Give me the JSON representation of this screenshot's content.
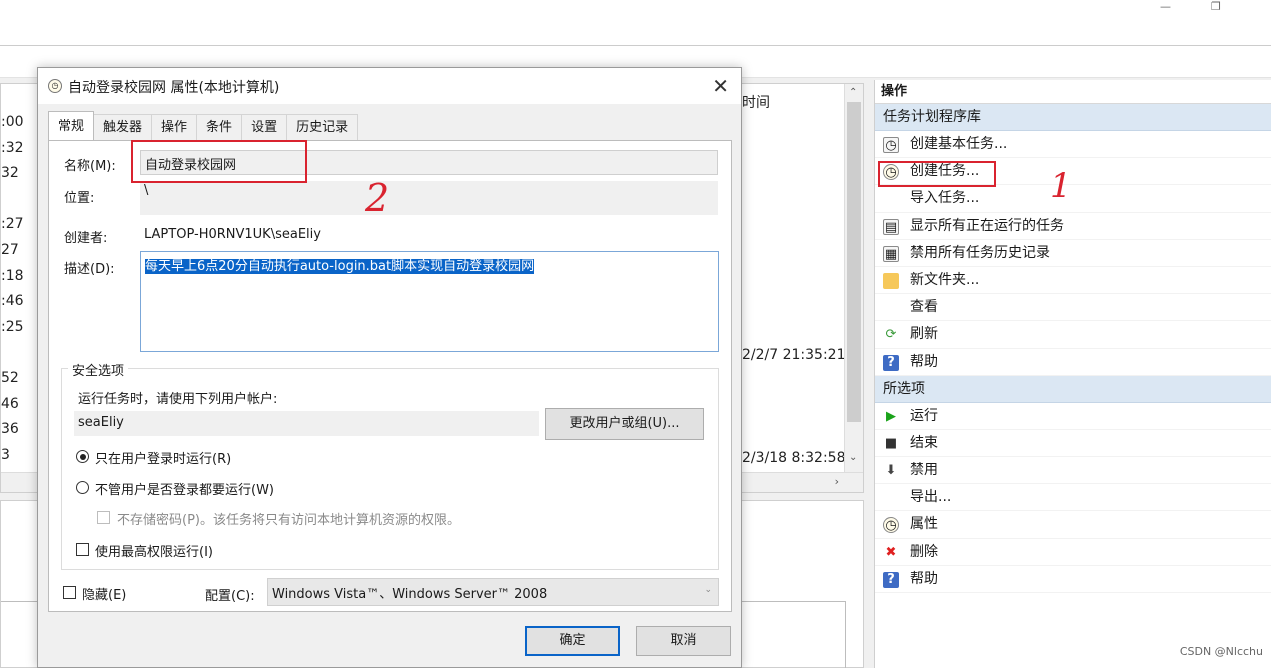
{
  "background": {
    "left_times": [
      ":00",
      ":32",
      "32",
      "",
      ":27",
      "27",
      ":18",
      ":46",
      ":25",
      "",
      "52",
      "46",
      "36",
      "3"
    ],
    "column_header": "时间",
    "dates": [
      "2/2/7 21:35:21",
      "2/3/18 8:32:58"
    ]
  },
  "actions": {
    "header": "操作",
    "section_library": "任务计划程序库",
    "library_items": [
      {
        "label": "创建基本任务...",
        "icon": "create-basic-task-icon"
      },
      {
        "label": "创建任务...",
        "icon": "create-task-icon"
      },
      {
        "label": "导入任务...",
        "icon": ""
      },
      {
        "label": "显示所有正在运行的任务",
        "icon": "running-tasks-icon"
      },
      {
        "label": "禁用所有任务历史记录",
        "icon": "history-icon"
      },
      {
        "label": "新文件夹...",
        "icon": "folder-icon"
      },
      {
        "label": "查看",
        "icon": ""
      },
      {
        "label": "刷新",
        "icon": "refresh-icon"
      },
      {
        "label": "帮助",
        "icon": "help-icon"
      }
    ],
    "section_selected": "所选项",
    "selected_items": [
      {
        "label": "运行",
        "icon": "run-icon"
      },
      {
        "label": "结束",
        "icon": "stop-icon"
      },
      {
        "label": "禁用",
        "icon": "disable-icon"
      },
      {
        "label": "导出...",
        "icon": ""
      },
      {
        "label": "属性",
        "icon": "properties-icon"
      },
      {
        "label": "删除",
        "icon": "delete-icon"
      },
      {
        "label": "帮助",
        "icon": "help-icon"
      }
    ]
  },
  "annotations": {
    "one": "1",
    "two": "2"
  },
  "dialog": {
    "title": "自动登录校园网 属性(本地计算机)",
    "tabs": [
      "常规",
      "触发器",
      "操作",
      "条件",
      "设置",
      "历史记录"
    ],
    "name_label": "名称(M):",
    "name_value": "自动登录校园网",
    "location_label": "位置:",
    "location_value": "\\",
    "author_label": "创建者:",
    "author_value": "LAPTOP-H0RNV1UK\\seaEliy",
    "desc_label": "描述(D):",
    "desc_value": "每天早上6点20分自动执行auto-login.bat脚本实现自动登录校园网",
    "security_title": "安全选项",
    "run_as_prompt": "运行任务时，请使用下列用户帐户:",
    "user_value": "seaEliy",
    "change_user_button": "更改用户或组(U)...",
    "radio_logged_on": "只在用户登录时运行(R)",
    "radio_any": "不管用户是否登录都要运行(W)",
    "no_store_password": "不存储密码(P)。该任务将只有访问本地计算机资源的权限。",
    "highest_privileges": "使用最高权限运行(I)",
    "hidden_label": "隐藏(E)",
    "config_label": "配置(C):",
    "config_value": "Windows Vista™、Windows Server™ 2008",
    "ok_button": "确定",
    "cancel_button": "取消"
  },
  "watermark": "CSDN @Nlcchu",
  "colors": {
    "accent": "#0a64c8",
    "annotation_red": "#d9232f",
    "section_bg": "#dbe7f3"
  }
}
